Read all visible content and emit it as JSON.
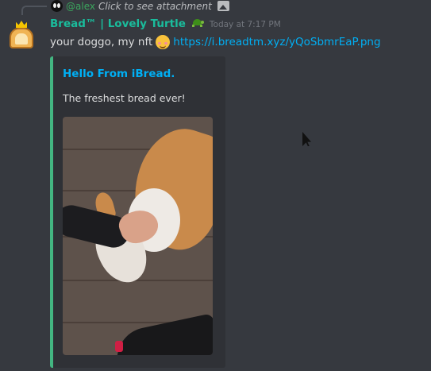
{
  "reply": {
    "username": "@alex",
    "text": "Click to see attachment",
    "icon": "image-icon"
  },
  "author": {
    "name": "Bread™ | Lovely Turtle",
    "role_icon": "turtle-icon",
    "avatar": "bread-crown-avatar",
    "name_color": "#1abc9c"
  },
  "timestamp": "Today at 7:17 PM",
  "message": {
    "text": "your doggo, my nft",
    "emoji": "blush-emoji",
    "link": "https://i.breadtm.xyz/yQoSbmrEaP.png",
    "link_color": "#00aff4"
  },
  "embed": {
    "title": "Hello From iBread.",
    "description": "The freshest bread ever!",
    "accent_color": "#43b581",
    "image": "dog-photo"
  },
  "theme": {
    "background": "#36393f",
    "embed_background": "#2f3136"
  }
}
